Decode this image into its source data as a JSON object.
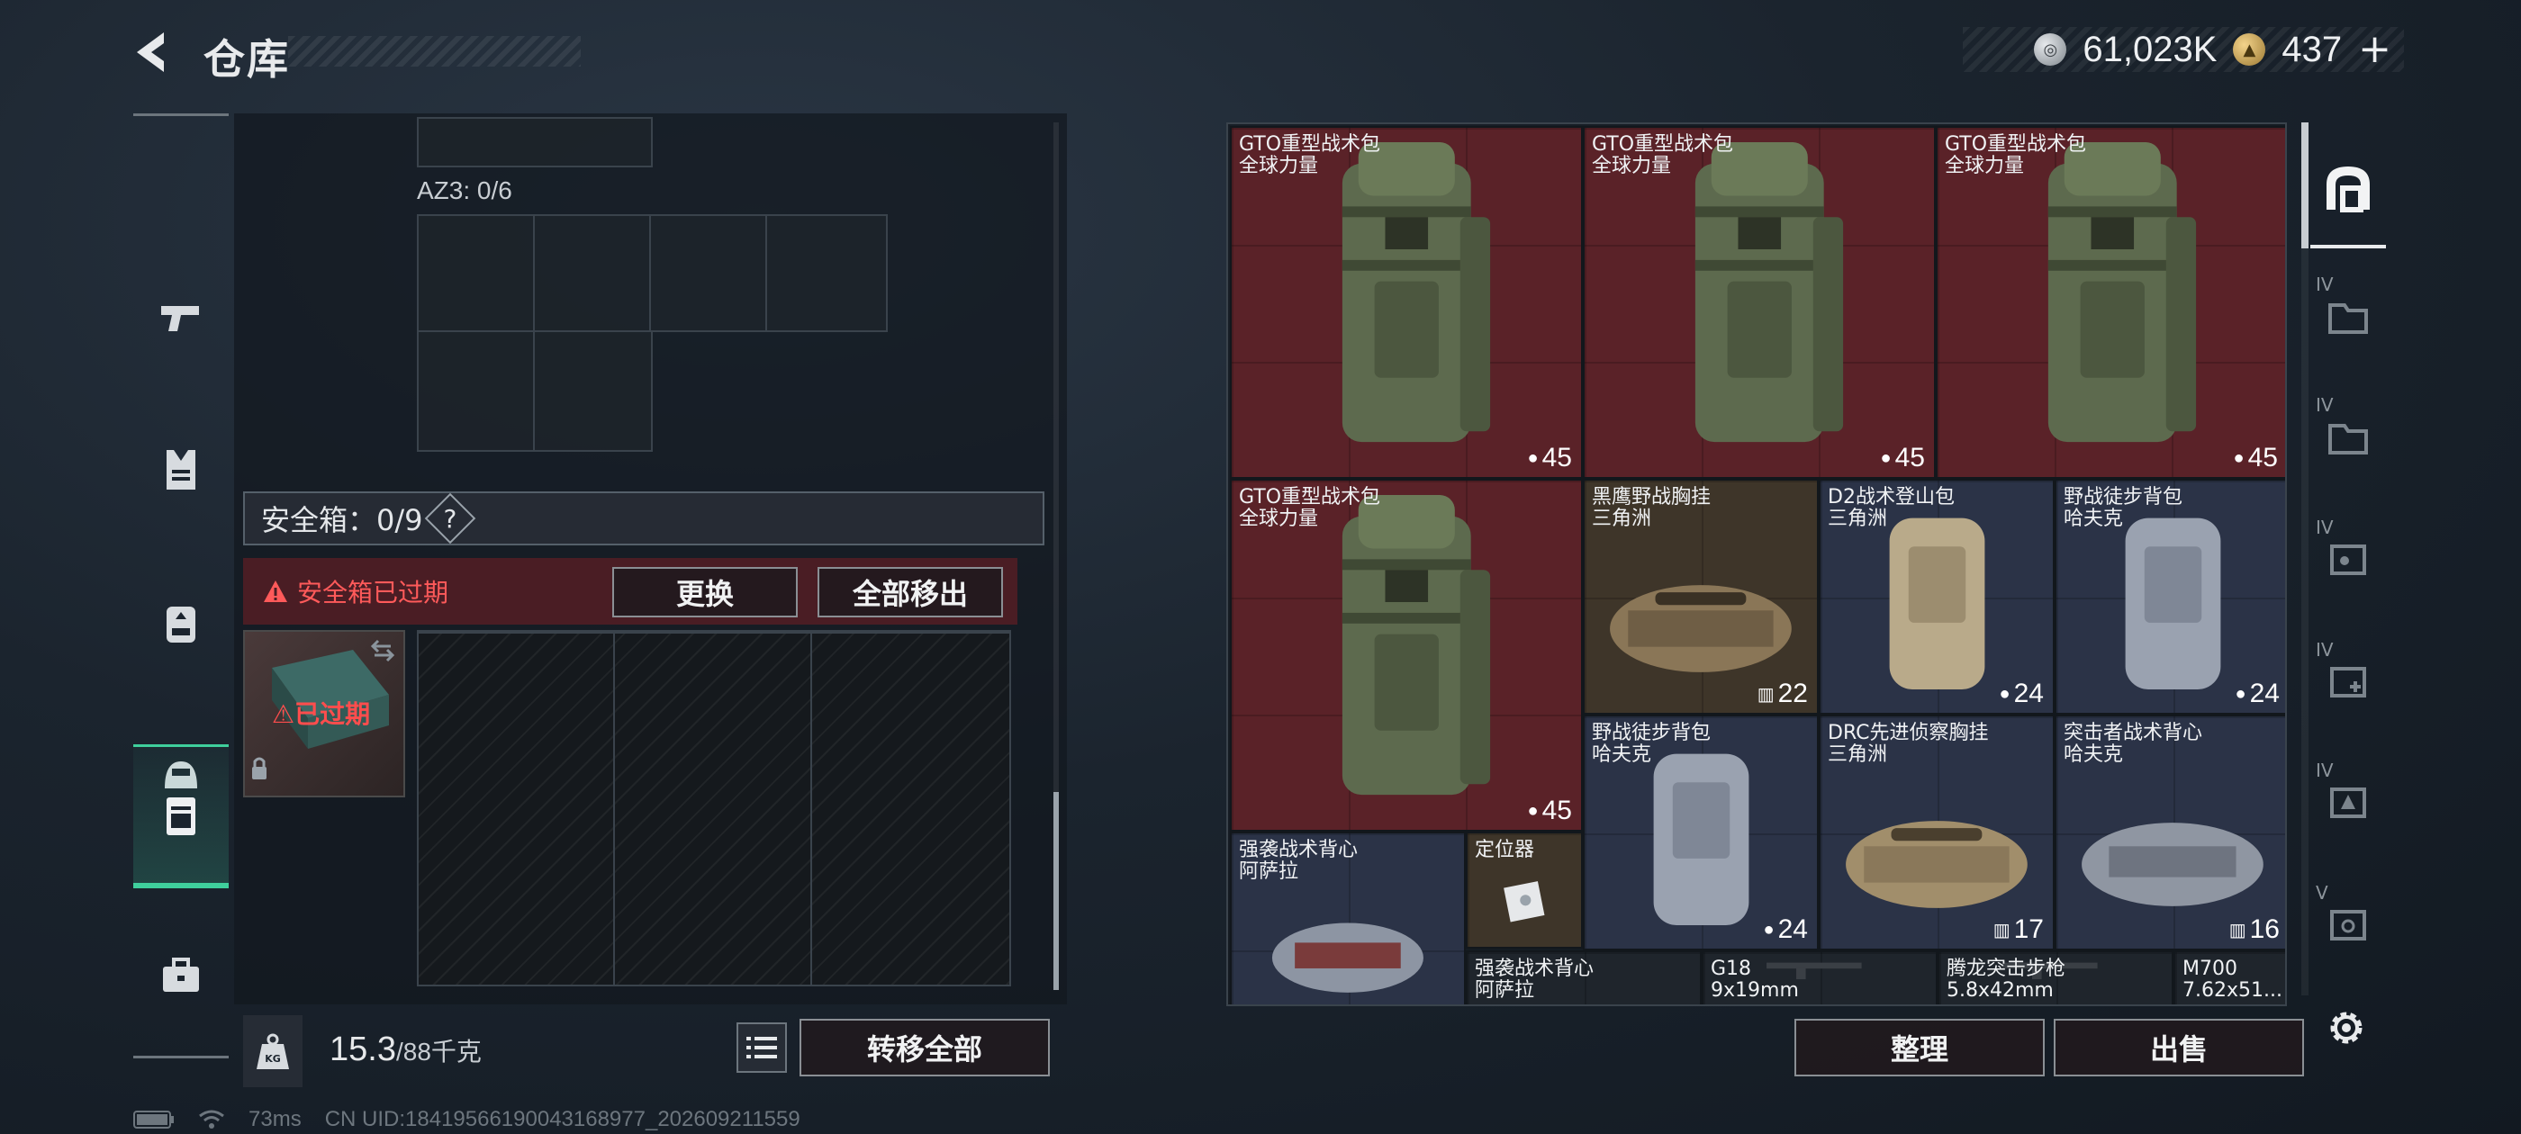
{
  "header": {
    "title": "仓库"
  },
  "currency": {
    "silver": "61,023K",
    "gold": "437",
    "plus": "+"
  },
  "left_sidebar": {
    "items": [
      {
        "name": "weapons",
        "icon": "pistol-icon"
      },
      {
        "name": "armor",
        "icon": "vest-icon"
      },
      {
        "name": "backpack",
        "icon": "backpack-icon"
      },
      {
        "name": "helmet",
        "icon": "helmet-icon"
      },
      {
        "name": "safe-box",
        "icon": "safe-box-icon",
        "active": true
      },
      {
        "name": "toolbox",
        "icon": "briefcase-icon"
      }
    ]
  },
  "loadout": {
    "az3_label": "AZ3: 0/6",
    "safe_box": {
      "title": "安全箱：0/9",
      "help": "?",
      "expired_warning": "安全箱已过期",
      "replace_label": "更换",
      "move_all_out_label": "全部移出",
      "item_badge": "已过期"
    }
  },
  "footer_left": {
    "weight_current": "15.3",
    "weight_max": "/88千克",
    "transfer_all_label": "转移全部"
  },
  "warehouse": {
    "items": [
      {
        "name": "GTO重型战术包",
        "sub": "全球力量",
        "count": "45",
        "color": "red"
      },
      {
        "name": "GTO重型战术包",
        "sub": "全球力量",
        "count": "45",
        "color": "red"
      },
      {
        "name": "GTO重型战术包",
        "sub": "全球力量",
        "count": "45",
        "color": "red"
      },
      {
        "name": "GTO重型战术包",
        "sub": "全球力量",
        "count": "45",
        "color": "red"
      },
      {
        "name": "黑鹰野战胸挂",
        "sub": "三角洲",
        "count": "22",
        "color": "brown"
      },
      {
        "name": "D2战术登山包",
        "sub": "三角洲",
        "count": "24",
        "color": "blue"
      },
      {
        "name": "野战徒步背包",
        "sub": "哈夫克",
        "count": "24",
        "color": "blue"
      },
      {
        "name": "野战徒步背包",
        "sub": "哈夫克",
        "count": "24",
        "color": "blue"
      },
      {
        "name": "DRC先进侦察胸挂",
        "sub": "三角洲",
        "count": "17",
        "color": "blue"
      },
      {
        "name": "突击者战术背心",
        "sub": "哈夫克",
        "count": "16",
        "color": "blue"
      },
      {
        "name": "强袭战术背心",
        "sub": "阿萨拉",
        "count": "",
        "color": "blue"
      },
      {
        "name": "定位器",
        "sub": "",
        "count": "",
        "color": "brown"
      },
      {
        "name": "强袭战术背心",
        "sub": "阿萨拉",
        "count": "",
        "color": "dark"
      },
      {
        "name": "G18",
        "sub": "9x19mm",
        "count": "",
        "color": "dark"
      },
      {
        "name": "腾龙突击步枪",
        "sub": "5.8x42mm",
        "count": "",
        "color": "dark"
      },
      {
        "name": "M700",
        "sub": "7.62x51...",
        "count": "",
        "color": "dark"
      }
    ]
  },
  "right_sidebar": {
    "labels": [
      "IV",
      "IV",
      "IV",
      "IV",
      "IV",
      "V"
    ]
  },
  "footer_right": {
    "sort_label": "整理",
    "sell_label": "出售"
  },
  "status": {
    "ping": "73ms",
    "uid": "CN UID:18419566190043168977_202609211559"
  },
  "colors": {
    "accent": "#3fcf9c",
    "danger": "#ff5a5a",
    "rare_red": "#5a2228",
    "epic_blue": "#2b3347",
    "tan": "#3e3529"
  }
}
